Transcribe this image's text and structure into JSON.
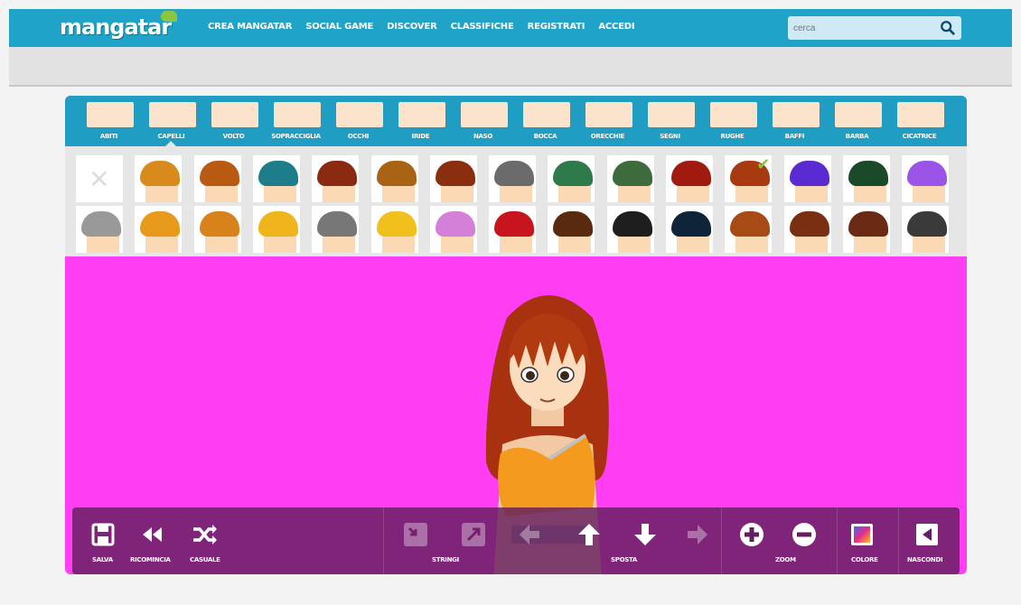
{
  "header": {
    "logo": "mangatar",
    "nav": [
      "CREA MANGATAR",
      "SOCIAL GAME",
      "DISCOVER",
      "CLASSIFICHE",
      "REGISTRATI",
      "ACCEDI"
    ],
    "search_placeholder": "cerca"
  },
  "categories": [
    {
      "label": "ABITI",
      "active": false
    },
    {
      "label": "CAPELLI",
      "active": true
    },
    {
      "label": "VOLTO",
      "active": false
    },
    {
      "label": "SOPRACCIGLIA",
      "active": false
    },
    {
      "label": "OCCHI",
      "active": false
    },
    {
      "label": "IRIDE",
      "active": false
    },
    {
      "label": "NASO",
      "active": false
    },
    {
      "label": "BOCCA",
      "active": false
    },
    {
      "label": "ORECCHIE",
      "active": false
    },
    {
      "label": "SEGNI",
      "active": false
    },
    {
      "label": "RUGHE",
      "active": false
    },
    {
      "label": "BAFFI",
      "active": false
    },
    {
      "label": "BARBA",
      "active": false
    },
    {
      "label": "CICATRICE",
      "active": false
    }
  ],
  "hair_colors": {
    "row1": [
      "remove",
      "#d88a1c",
      "#b85a12",
      "#1d7d8a",
      "#8a2a10",
      "#a86414",
      "#8a2e10",
      "#6b6b6b",
      "#2f7a4a",
      "#3d6b3d",
      "#a01a10",
      "#a83a10",
      "#5a2bd0",
      "#1a4a2a",
      "#9a55e8"
    ],
    "row2": [
      "#999999",
      "#e89a1c",
      "#d8821c",
      "#f0b41c",
      "#777777",
      "#f0c01c",
      "#d47fd8",
      "#c8141e",
      "#5a2a10",
      "#1e1e1e",
      "#0e2438",
      "#a84a14",
      "#7a3010",
      "#6a2a14",
      "#3a3a3a"
    ],
    "selected_row1_index": 12
  },
  "toolbar": {
    "save": "SALVA",
    "restart": "RICOMINCIA",
    "random": "CASUALE",
    "squeeze": "STRINGI",
    "move": "SPOSTA",
    "zoom": "ZOOM",
    "color": "COLORE",
    "hide": "NASCONDI"
  },
  "colors": {
    "brand": "#1fa3c9",
    "canvas": "#ff3df2",
    "toolbar": "#641e5f",
    "check": "#8cc63f"
  }
}
